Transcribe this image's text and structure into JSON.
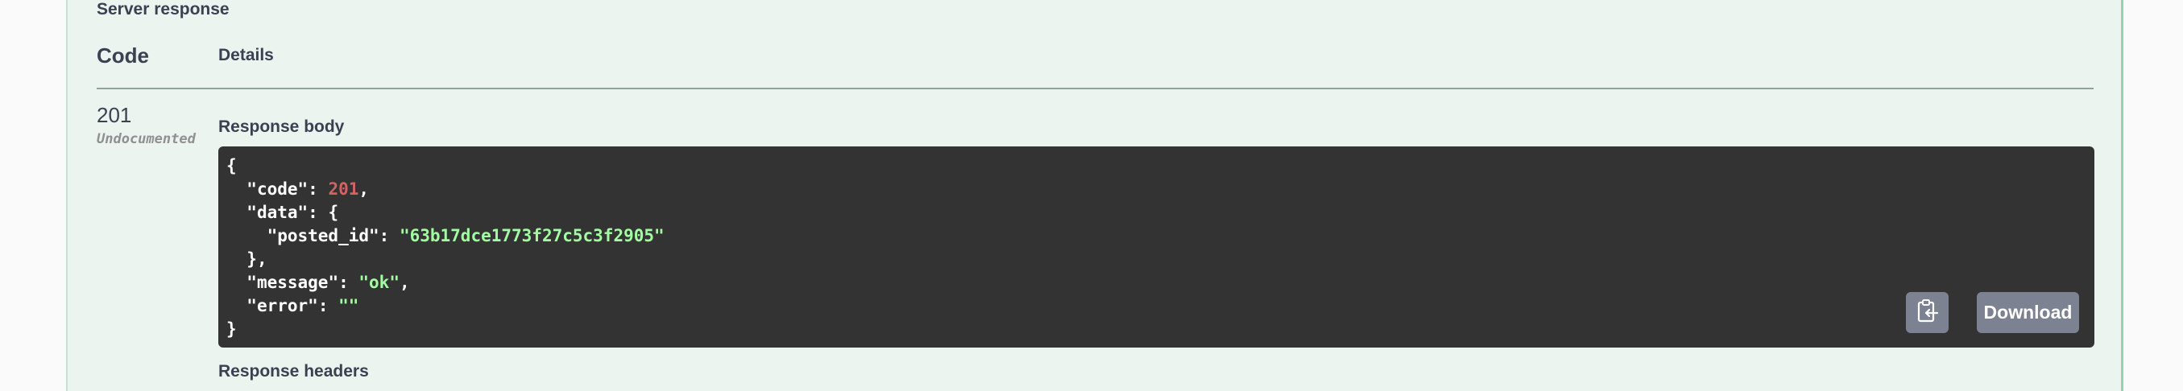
{
  "server_response": {
    "title": "Server response",
    "headers": {
      "code": "Code",
      "details": "Details"
    }
  },
  "response": {
    "status_code": "201",
    "status_note": "Undocumented",
    "body_label": "Response body",
    "body": {
      "line_open": "{",
      "code_key": "\"code\"",
      "code_value": "201",
      "data_key": "\"data\"",
      "posted_id_key": "\"posted_id\"",
      "posted_id_value": "\"63b17dce1773f27c5c3f2905\"",
      "data_close": "},",
      "message_key": "\"message\"",
      "message_value": "\"ok\"",
      "error_key": "\"error\"",
      "error_value": "\"\"",
      "line_close": "}"
    },
    "download_label": "Download",
    "copy_icon": "clipboard-copy-icon",
    "headers_label": "Response headers"
  },
  "colors": {
    "panel_bg": "#ebf4ef",
    "code_bg": "#333333",
    "number": "#d36363",
    "string": "#a2fca2",
    "button_bg": "#7d8293"
  }
}
